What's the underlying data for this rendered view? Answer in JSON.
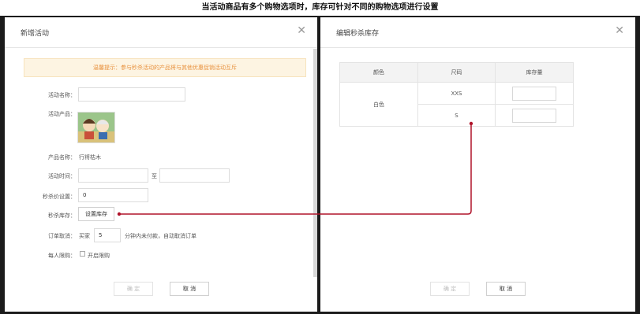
{
  "banner": "当活动商品有多个购物选项时，库存可针对不同的购物选项进行设置",
  "left": {
    "title": "新增活动",
    "tip": "温馨提示：参与秒杀活动的产品将与其他优惠促销活动互斥",
    "labels": {
      "name": "活动名称：",
      "product": "活动产品：",
      "product_name": "产品名称：",
      "time": "活动时间：",
      "price": "秒杀价设置：",
      "stock": "秒杀库存：",
      "cancel_order": "订单取消：",
      "limit": "每人限购："
    },
    "product_name_value": "行将枯木",
    "time_sep": "至",
    "price_value": "0",
    "stock_button": "设置库存",
    "cancel_prefix": "买家",
    "cancel_minutes": "5",
    "cancel_suffix": "分钟内未付款，自动取消订单",
    "limit_text": "开启限购",
    "ok": "确 定",
    "cancel": "取 消"
  },
  "right": {
    "title": "编辑秒杀库存",
    "table": {
      "headers": [
        "颜色",
        "尺码",
        "库存量"
      ],
      "color": "白色",
      "sizes": [
        "XXS",
        "S"
      ]
    },
    "ok": "确 定",
    "cancel": "取 消"
  },
  "colors": {
    "connector": "#b0132a",
    "tip_text": "#e8913d"
  },
  "icons": {
    "close": "close-icon"
  }
}
